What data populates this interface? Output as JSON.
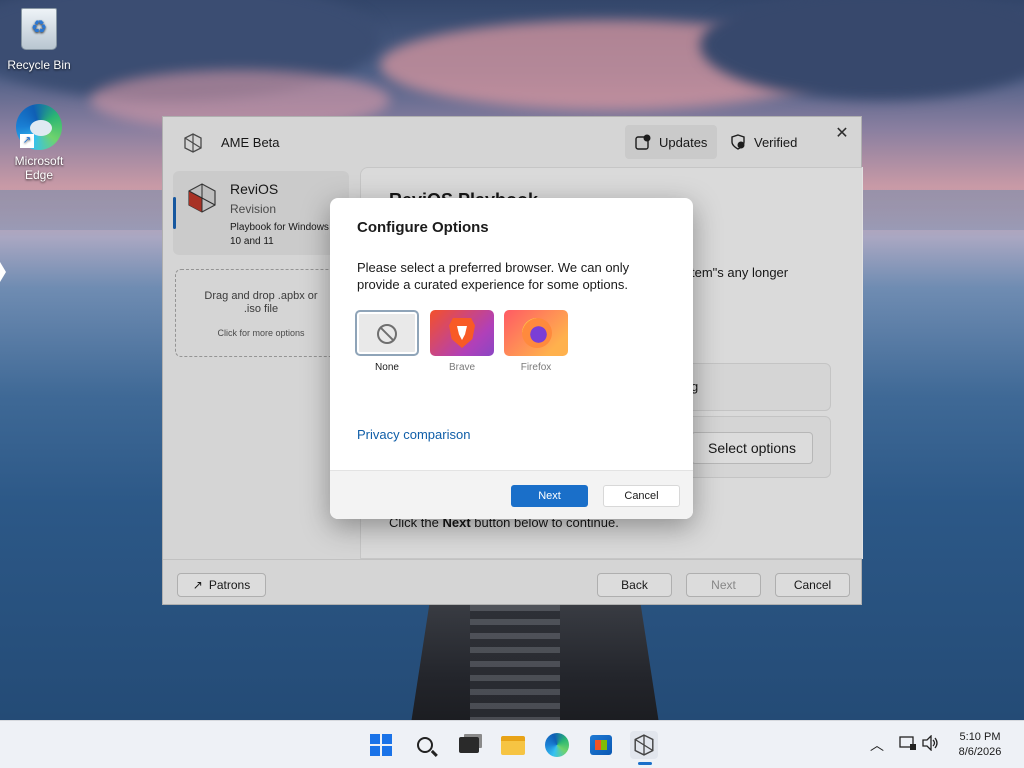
{
  "desktop": {
    "icons": [
      {
        "label": "Recycle Bin"
      },
      {
        "label": "Microsoft Edge"
      }
    ]
  },
  "ame": {
    "title": "AME Beta",
    "updates_label": "Updates",
    "verified_label": "Verified",
    "playbook": {
      "name": "ReviOS",
      "subtitle": "Revision",
      "description": "Playbook for Windows 10 and 11"
    },
    "dropzone": {
      "line1": "Drag and drop .apbx or .iso file",
      "line2": "Click for more options"
    },
    "main": {
      "heading": "ReviOS Playbook",
      "partial_text": "tem\"s any longer",
      "row1_partial": "g",
      "select_options": "Select options",
      "footer_prefix": "Click the ",
      "footer_bold": "Next",
      "footer_suffix": " button below to continue."
    },
    "buttons": {
      "patrons": "Patrons",
      "back": "Back",
      "next": "Next",
      "cancel": "Cancel"
    }
  },
  "dialog": {
    "title": "Configure Options",
    "description": "Please select a preferred browser. We can only provide a curated experience for some options.",
    "options": [
      {
        "label": "None",
        "selected": true
      },
      {
        "label": "Brave",
        "selected": false
      },
      {
        "label": "Firefox",
        "selected": false
      }
    ],
    "privacy_link": "Privacy comparison",
    "next": "Next",
    "cancel": "Cancel"
  },
  "taskbar": {
    "time": "5:10 PM",
    "date": "8/6/2026",
    "accent": "#1a6fc9"
  }
}
